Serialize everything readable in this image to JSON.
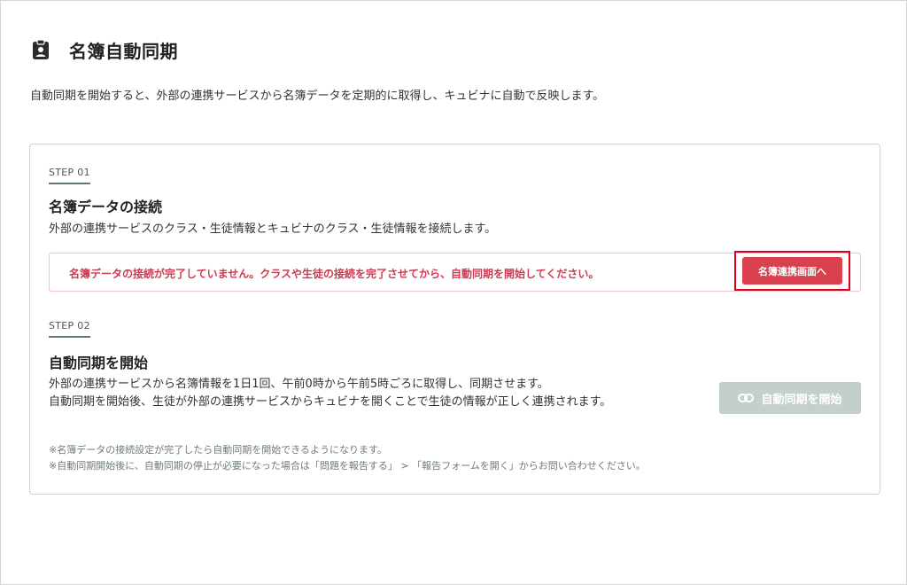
{
  "header": {
    "title": "名簿自動同期",
    "icon": "clipboard-user-icon"
  },
  "description": "自動同期を開始すると、外部の連携サービスから名簿データを定期的に取得し、キュビナに自動で反映します。",
  "steps": [
    {
      "label": "STEP 01",
      "title": "名簿データの接続",
      "text": "外部の連携サービスのクラス・生徒情報とキュビナのクラス・生徒情報を接続します。",
      "alert": {
        "message": "名簿データの接続が完了していません。クラスや生徒の接続を完了させてから、自動同期を開始してください。",
        "button_label": "名簿連携画面へ"
      }
    },
    {
      "label": "STEP 02",
      "title": "自動同期を開始",
      "lines": [
        "外部の連携サービスから名簿情報を1日1回、午前0時から午前5時ごろに取得し、同期させます。",
        "自動同期を開始後、生徒が外部の連携サービスからキュビナを開くことで生徒の情報が正しく連携されます。"
      ],
      "button_label": "自動同期を開始",
      "button_icon": "link-icon"
    }
  ],
  "notes": [
    "※名簿データの接続設定が完了したら自動同期を開始できるようになります。",
    "※自動同期開始後に、自動同期の停止が必要になった場合は「問題を報告する」 > 「報告フォームを開く」からお問い合わせください。"
  ],
  "colors": {
    "accent_green": "#5d7a6a",
    "alert_red": "#d0394f",
    "button_red": "#d9414f",
    "disabled_button": "#c5cfc9",
    "highlight_box": "#e0001a"
  }
}
